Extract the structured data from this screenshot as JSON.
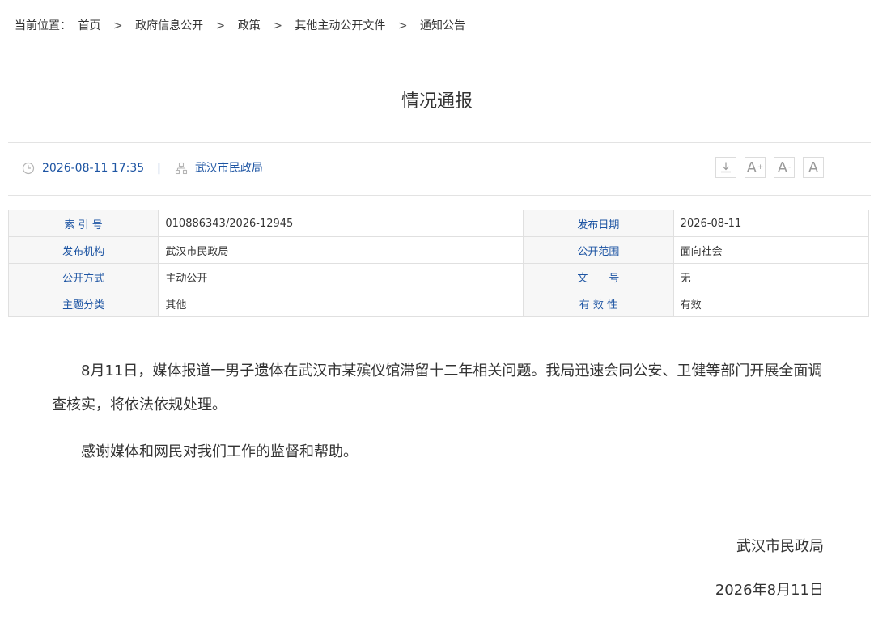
{
  "breadcrumb": {
    "prefix": "当前位置：",
    "items": [
      "首页",
      "政府信息公开",
      "政策",
      "其他主动公开文件",
      "通知公告"
    ],
    "separator": ">"
  },
  "article": {
    "title": "情况通报",
    "datetime": "2026-08-11 17:35",
    "meta_separator": "|",
    "source": "武汉市民政局"
  },
  "tools": {
    "download_icon": "download-icon",
    "font_increase": "A",
    "font_decrease": "A",
    "font_reset": "A",
    "plus": "+",
    "minus": "-"
  },
  "info_table": {
    "rows": [
      {
        "label1": "索 引 号",
        "value1": "010886343/2026-12945",
        "label2": "发布日期",
        "value2": "2026-08-11"
      },
      {
        "label1": "发布机构",
        "value1": "武汉市民政局",
        "label2": "公开范围",
        "value2": "面向社会"
      },
      {
        "label1": "公开方式",
        "value1": "主动公开",
        "label2": "文　　号",
        "value2": "无"
      },
      {
        "label1": "主题分类",
        "value1": "其他",
        "label2": "有 效 性",
        "value2": "有效"
      }
    ]
  },
  "body": {
    "paragraphs": [
      "8月11日，媒体报道一男子遗体在武汉市某殡仪馆滞留十二年相关问题。我局迅速会同公安、卫健等部门开展全面调查核实，将依法依规处理。",
      "感谢媒体和网民对我们工作的监督和帮助。"
    ],
    "signature_org": "武汉市民政局",
    "signature_date": "2026年8月11日"
  },
  "colors": {
    "accent": "#1e55a3",
    "label_bg": "#f7f7f7",
    "border": "#e0e0e0",
    "text": "#333333"
  }
}
